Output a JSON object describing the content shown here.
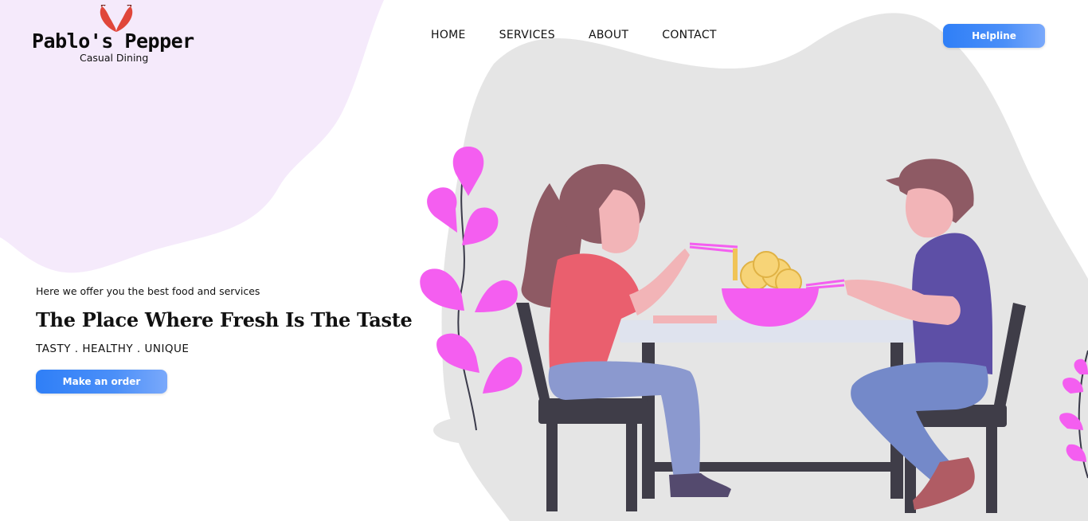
{
  "brand": {
    "name": "Pablo's Pepper",
    "tagline": "Casual Dining",
    "logo_icon": "chili-pepper-icon",
    "logo_color": "#e0463a"
  },
  "nav": {
    "items": [
      {
        "label": "HOME"
      },
      {
        "label": "SERVICES"
      },
      {
        "label": "ABOUT"
      },
      {
        "label": "CONTACT"
      }
    ],
    "helpline_label": "Helpline"
  },
  "hero": {
    "tagline": "Here we offer you the best food and services",
    "title": "The Place Where Fresh Is The Taste",
    "keywords": "TASTY . HEALTHY . UNIQUE",
    "cta_label": "Make an order"
  },
  "colors": {
    "accent_gradient_start": "#2f7ff7",
    "accent_gradient_end": "#7aa9fb",
    "blob_lavender": "#f5eafb",
    "blob_gray": "#e4e4e4",
    "plant_pink": "#f45ef0"
  }
}
